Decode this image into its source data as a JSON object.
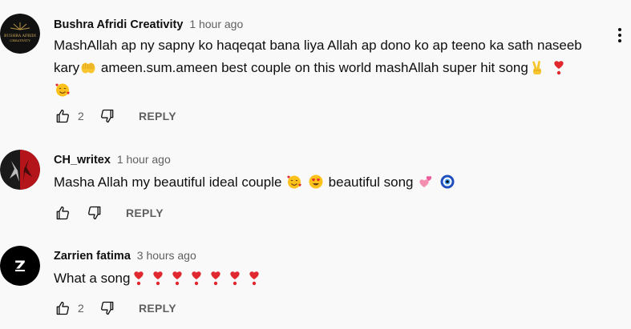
{
  "comments": [
    {
      "author": "Bushra Afridi Creativity",
      "time": "1 hour ago",
      "avatar_text_line1": "BUSHRA AFRIDI",
      "avatar_text_line2": "CREATIVITY",
      "text_parts": [
        "MashAllah ap ny sapny ko haqeqat bana liya Allah ap dono ko ap teeno ka sath naseeb kary",
        "ameen.sum.ameen best couple on this world mashAllah super hit song"
      ],
      "emojis": [
        "open-hands-emoji",
        "victory-hand-emoji",
        "heart-exclamation-emoji",
        "smiling-face-with-hearts-emoji"
      ],
      "likes": "2",
      "reply_label": "REPLY"
    },
    {
      "author": "CH_writex",
      "time": "1 hour ago",
      "text_parts": [
        "Masha Allah my beautiful ideal couple",
        "beautiful song"
      ],
      "emojis": [
        "smiling-face-with-hearts-emoji",
        "heart-eyes-emoji",
        "two-hearts-emoji",
        "nazar-amulet-emoji"
      ],
      "likes": "",
      "reply_label": "REPLY"
    },
    {
      "author": "Zarrien fatima",
      "time": "3 hours ago",
      "avatar_letter": "Z",
      "text_parts": [
        "What a song"
      ],
      "emojis": [
        "heart-exclamation-emoji"
      ],
      "emoji_repeat": 7,
      "likes": "2",
      "reply_label": "REPLY"
    }
  ],
  "colors": {
    "background": "#f9f9f9",
    "primary_text": "#0f0f0f",
    "secondary_text": "#606060",
    "heart_red": "#e0282e"
  }
}
